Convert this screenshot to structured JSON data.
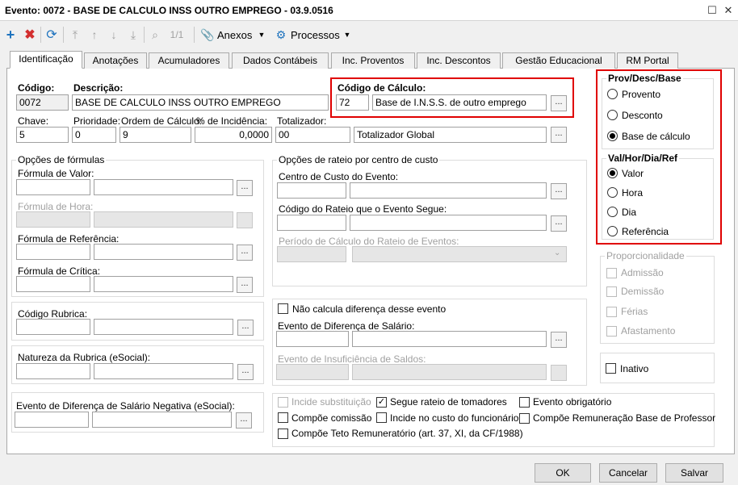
{
  "window": {
    "title": "Evento: 0072 - BASE DE CALCULO INSS OUTRO EMPREGO - 03.9.0516"
  },
  "toolbar": {
    "page_counter": "1/1",
    "anexos_label": "Anexos",
    "processos_label": "Processos"
  },
  "tabs": [
    "Identificação",
    "Anotações",
    "Acumuladores",
    "Dados Contábeis",
    "Inc. Proventos",
    "Inc. Descontos",
    "Gestão Educacional",
    "RM Portal"
  ],
  "form": {
    "codigo": {
      "label": "Código:",
      "value": "0072"
    },
    "descricao": {
      "label": "Descrição:",
      "value": "BASE DE CALCULO INSS OUTRO EMPREGO"
    },
    "codigo_calculo": {
      "label": "Código de Cálculo:",
      "value": "72",
      "description": "Base de I.N.S.S. de outro emprego"
    },
    "chave": {
      "label": "Chave:",
      "value": "5"
    },
    "prioridade": {
      "label": "Prioridade:",
      "value": "0"
    },
    "ordem_calculo": {
      "label": "Ordem de Cálculo:",
      "value": "9"
    },
    "incidencia": {
      "label": "% de Incidência:",
      "value": "0,0000"
    },
    "totalizador": {
      "label": "Totalizador:",
      "value": "00",
      "description": "Totalizador Global"
    }
  },
  "formulas": {
    "title": "Opções de fórmulas",
    "valor": "Fórmula de Valor:",
    "hora": "Fórmula de Hora:",
    "referencia": "Fórmula de Referência:",
    "critica": "Fórmula de Crítica:"
  },
  "rateio": {
    "title": "Opções de rateio por centro de custo",
    "centro": "Centro de Custo do Evento:",
    "codigo_rateio": "Código do Rateio que o Evento Segue:",
    "periodo": "Período de Cálculo do Rateio de Eventos:"
  },
  "rubrica": {
    "codigo": "Código Rubrica:",
    "natureza": "Natureza da Rubrica (eSocial):",
    "negativa": "Evento de Diferença de Salário Negativa (eSocial):"
  },
  "diferenca": {
    "nao_calcula": "Não calcula diferença desse evento",
    "evento_diferenca": "Evento de Diferença de Salário:",
    "insuficiencia": "Evento de Insuficiência de Saldos:"
  },
  "options": {
    "incide_substituicao": "Incide substituição",
    "compoe_comissao": "Compõe comissão",
    "compoe_teto": "Compõe Teto Remuneratório (art. 37, XI, da CF/1988)",
    "segue_rateio": "Segue rateio de tomadores",
    "incide_custo": "Incide no custo do funcionário",
    "evento_obrigatorio": "Evento obrigatório",
    "compoe_remuneracao": "Compõe Remuneração Base de Professor"
  },
  "prov_desc_base": {
    "title": "Prov/Desc/Base",
    "items": [
      "Provento",
      "Desconto",
      "Base de cálculo"
    ],
    "selected": "Base de cálculo"
  },
  "val_hor": {
    "title": "Val/Hor/Dia/Ref",
    "items": [
      "Valor",
      "Hora",
      "Dia",
      "Referência"
    ],
    "selected": "Valor"
  },
  "proporcionalidade": {
    "title": "Proporcionalidade",
    "items": [
      "Admissão",
      "Demissão",
      "Férias",
      "Afastamento"
    ]
  },
  "inativo": "Inativo",
  "buttons": {
    "ok": "OK",
    "cancelar": "Cancelar",
    "salvar": "Salvar"
  },
  "colors": {
    "highlight": "#e00000",
    "add_icon": "#1e73be",
    "delete_icon": "#d32f2f"
  }
}
